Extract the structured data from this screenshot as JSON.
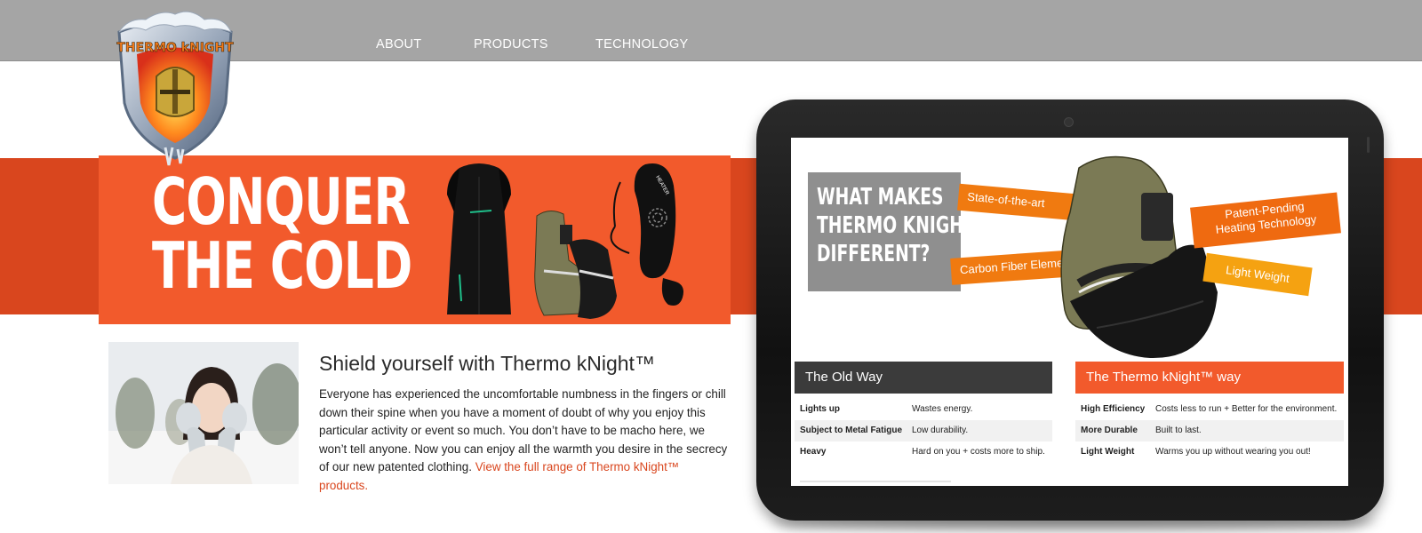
{
  "nav": {
    "items": [
      "ABOUT",
      "PRODUCTS",
      "TECHNOLOGY"
    ]
  },
  "logo": {
    "text": "THERMO kNIGHT"
  },
  "hero": {
    "headline_line1": "CONQUER",
    "headline_line2": "THE COLD",
    "product_label": "HEATER"
  },
  "intro": {
    "title": "Shield yourself with Thermo kNight™",
    "body": "Everyone has experienced the uncomfortable numbness in the fingers or chill down their spine when you have a moment of doubt of why you enjoy this particular activity or event so much. You don’t have to be macho here, we won’t tell anyone. Now you can enjoy all the warmth you desire in the secrecy of our new patented clothing.",
    "link": "View the full range of Thermo kNight™ products."
  },
  "tablet": {
    "what_makes": [
      "WHAT MAKES",
      "THERMO KNIGHT",
      "DIFFERENT?"
    ],
    "features": [
      {
        "label": "State-of-the-art"
      },
      {
        "label": "Carbon Fiber Element"
      },
      {
        "label": "Patent-Pending\nHeating Technology"
      },
      {
        "label": "Light Weight"
      }
    ],
    "old_way": {
      "title": "The Old Way",
      "rows": [
        {
          "key": "Lights up",
          "value": "Wastes energy."
        },
        {
          "key": "Subject to Metal Fatigue",
          "value": "Low durability."
        },
        {
          "key": "Heavy",
          "value": "Hard on you + costs more to ship."
        }
      ]
    },
    "new_way": {
      "title": "The Thermo kNight™ way",
      "rows": [
        {
          "key": "High Efficiency",
          "value": "Costs less to run + Better for the environment."
        },
        {
          "key": "More Durable",
          "value": "Built to last."
        },
        {
          "key": "Light Weight",
          "value": "Warms you up without wearing you out!"
        }
      ]
    }
  },
  "colors": {
    "header_gray": "#a5a5a5",
    "brand_orange": "#f25a2c",
    "band_red": "#d9461e",
    "feature_orange": "#f07a10",
    "old_way_dark": "#3b3b3b"
  }
}
